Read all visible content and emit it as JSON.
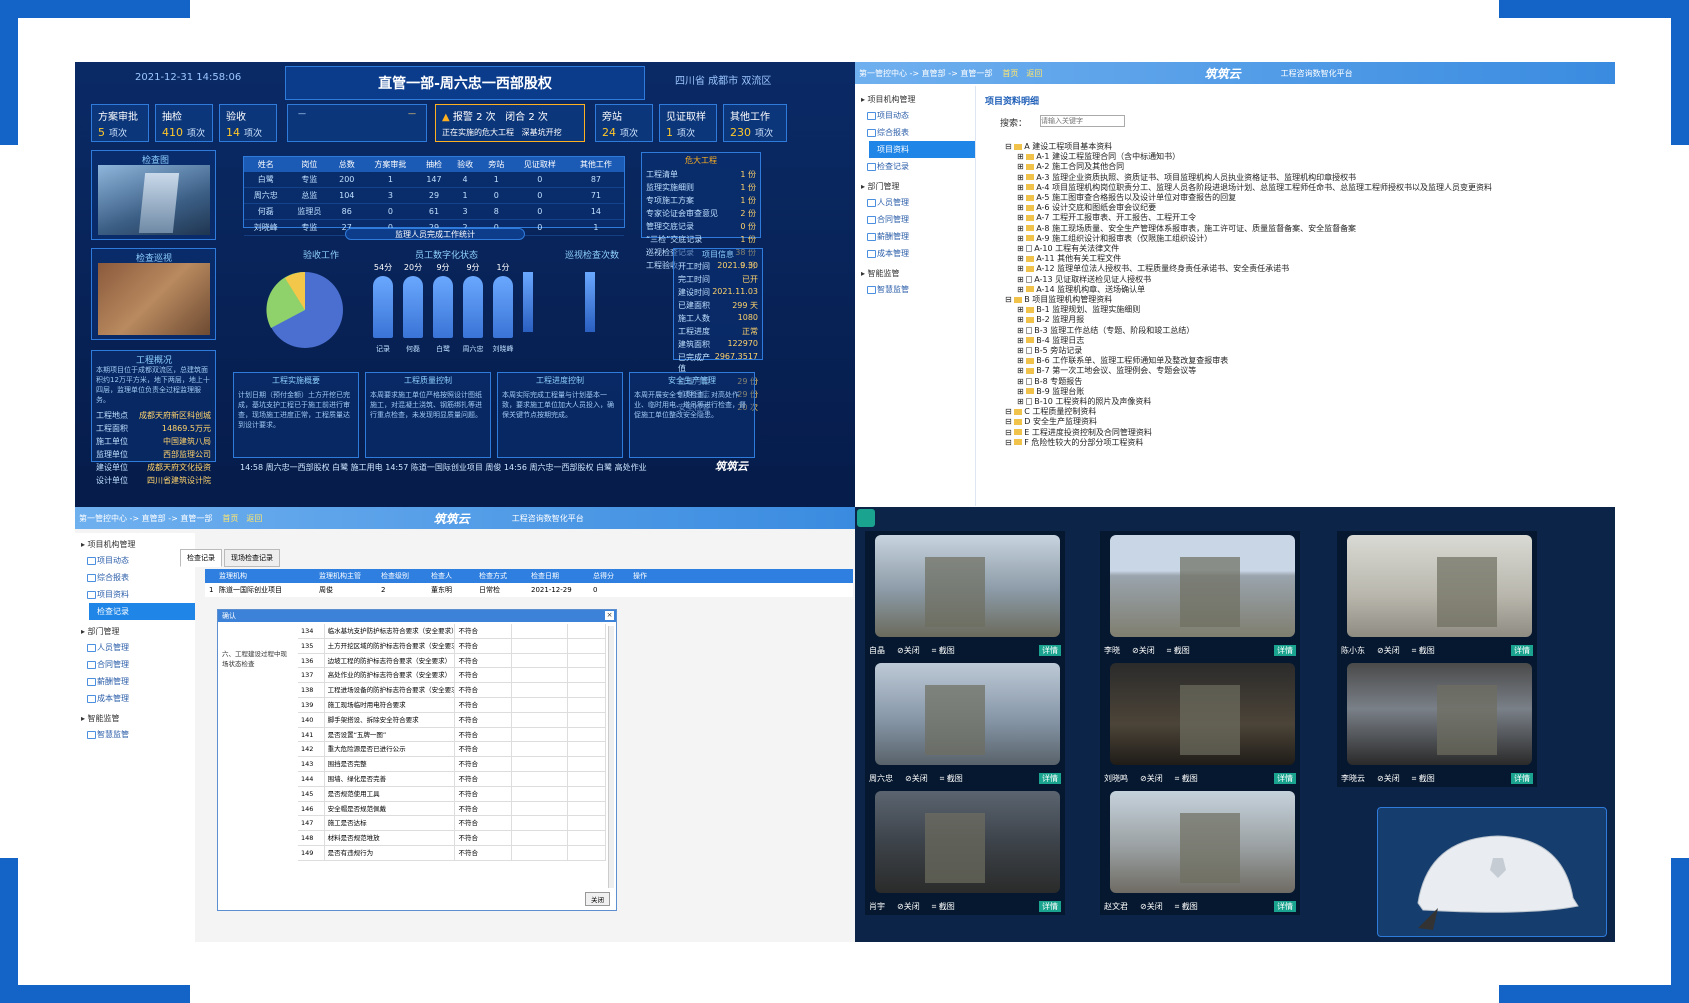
{
  "dashboard": {
    "datetime": "2021-12-31  14:58:06",
    "title": "直管一部-周六忠一西部股权",
    "location": "四川省 成都市 双流区",
    "stats": [
      {
        "label": "方案审批",
        "value": "5",
        "unit": "项次"
      },
      {
        "label": "抽检",
        "value": "410",
        "unit": "项次"
      },
      {
        "label": "验收",
        "value": "14",
        "unit": "项次"
      },
      {
        "label": "旁站",
        "value": "24",
        "unit": "项次"
      },
      {
        "label": "见证取样",
        "value": "1",
        "unit": "项次"
      },
      {
        "label": "其他工作",
        "value": "230",
        "unit": "项次"
      }
    ],
    "alarm": {
      "label": "报警",
      "count": "2 次",
      "label2": "闭合",
      "count2": "2 次",
      "note": "正在实施的危大工程",
      "note2": "深基坑开挖"
    },
    "section_img1": "检查图",
    "section_img2": "检查巡视",
    "table_headers": [
      "姓名",
      "岗位",
      "总数",
      "方案审批",
      "抽检",
      "验收",
      "旁站",
      "见证取样",
      "其他工作"
    ],
    "table_rows": [
      [
        "白鹭",
        "专监",
        "200",
        "1",
        "147",
        "4",
        "1",
        "0",
        "87"
      ],
      [
        "周六忠",
        "总监",
        "104",
        "3",
        "29",
        "1",
        "0",
        "0",
        "71"
      ],
      [
        "何磊",
        "监理员",
        "86",
        "0",
        "61",
        "3",
        "8",
        "0",
        "14"
      ],
      [
        "刘晓峰",
        "专监",
        "27",
        "0",
        "29",
        "2",
        "0",
        "0",
        "1"
      ]
    ],
    "table_footer": "监理人员完成工作统计",
    "danger_title": "危大工程",
    "danger_items": [
      [
        "工程清单",
        "1 份"
      ],
      [
        "监理实施细则",
        "1 份"
      ],
      [
        "专项施工方案",
        "1 份"
      ],
      [
        "专家论证会审查意见",
        "2 份"
      ],
      [
        "管理交底记录",
        "0 份"
      ],
      [
        "“三检”交底记录",
        "1 份"
      ],
      [
        "巡视检查记录",
        "38 份"
      ],
      [
        "工程验收",
        "0 份"
      ]
    ],
    "pie_title": "验收工作",
    "workers_title": "员工数字化状态",
    "workers": [
      {
        "time": "54分",
        "name": "记录"
      },
      {
        "time": "20分",
        "name": "何磊"
      },
      {
        "time": "9分",
        "name": "白鹭"
      },
      {
        "time": "9分",
        "name": "周六忠"
      },
      {
        "time": "1分",
        "name": "刘晓峰"
      }
    ],
    "bars_title": "巡视检查次数",
    "proj_title": "项目信息",
    "proj_items": [
      [
        "开工时间",
        "2021.9.30"
      ],
      [
        "完工时间",
        "已开"
      ],
      [
        "建设时间",
        "2021.11.03"
      ],
      [
        "已建面积",
        "299 天"
      ],
      [
        "施工人数",
        "1080"
      ],
      [
        "工程进度",
        "正常"
      ],
      [
        "建筑面积",
        "122970"
      ],
      [
        "已完成产值",
        "2967.3517"
      ],
      [
        "监理月报",
        "29 份"
      ],
      [
        "监理日志",
        "29 份"
      ],
      [
        "安全检查",
        "20 次"
      ]
    ],
    "overview_title": "工程概况",
    "overview_text": "本期项目位于成都双流区，总建筑面积约12万平方米，地下两层，地上十四层，监理单位负责全过程监理服务。",
    "overview_kv": [
      [
        "工程地点",
        "成都天府新区科创城"
      ],
      [
        "工程面积",
        "14869.5万元"
      ],
      [
        "施工单位",
        "中国建筑八局"
      ],
      [
        "监理单位",
        "西部监理公司"
      ],
      [
        "建设单位",
        "成都天府文化投资"
      ],
      [
        "设计单位",
        "四川省建筑设计院"
      ]
    ],
    "boxes": [
      {
        "title": "工程实施概要",
        "text": "计划日期（预付金额）土方开挖已完成，基坑支护工程已于施工前进行审查，现场施工进度正常，工程质量达到设计要求。"
      },
      {
        "title": "工程质量控制",
        "text": "本周要求施工单位严格按照设计图纸施工，对混凝土浇筑、钢筋绑扎等进行重点检查，未发现明显质量问题。"
      },
      {
        "title": "工程进度控制",
        "text": "本周实际完成工程量与计划基本一致，要求施工单位加大人员投入，确保关键节点按期完成。"
      },
      {
        "title": "安全生产管理",
        "text": "本周开展安全专项检查，对高处作业、临时用电、塔吊等进行检查，督促施工单位整改安全隐患。"
      }
    ],
    "ticker": "14:58  周六忠一西部股权  白鹭  施工用电    14:57  陈道一国际创业项目  周俊    14:56  周六忠一西部股权  白鹭  高处作业",
    "brand": "筑筑云"
  },
  "docs": {
    "breadcrumb": "第一管控中心 -> 直管部 -> 直管一部",
    "crumb_tabs": [
      "首页",
      "返回"
    ],
    "brand": "筑筑云",
    "brand_sub": "工程咨询数智化平台",
    "side": [
      {
        "group": "项目机构管理",
        "items": [
          "项目动态",
          "综合报表",
          "项目资料",
          "检查记录"
        ],
        "active": 2
      },
      {
        "group": "部门管理",
        "items": [
          "人员管理",
          "合同管理",
          "薪酬管理",
          "成本管理"
        ],
        "active": -1
      },
      {
        "group": "智能监管",
        "items": [
          "智慧监管"
        ],
        "active": -1
      }
    ],
    "section_title": "项目资料明细",
    "search_label": "搜索：",
    "search_placeholder": "请输入关键字",
    "tree": [
      "A 建设工程项目基本资料",
      "A-1 建设工程监理合同（含中标通知书）",
      "A-2 施工合同及其他合同",
      "A-3 监理企业资质执照、资质证书、项目监理机构人员执业资格证书、监理机构印章授权书",
      "A-4 项目监理机构岗位职责分工、监理人员各阶段进退场计划、总监理工程师任命书、总监理工程师授权书以及监理人员变更资料",
      "A-5 施工图审查合格报告以及设计单位对审查报告的回复",
      "A-6 设计交底和图纸会审会议纪要",
      "A-7 工程开工报审表、开工报告、工程开工令",
      "A-8 施工现场质量、安全生产管理体系报审表，施工许可证、质量监督备案、安全监督备案",
      "A-9 施工组织设计和报审表（仅限施工组织设计）",
      "A-10 工程有关法律文件",
      "A-11 其他有关工程文件",
      "A-12 监理单位法人授权书、工程质量终身责任承诺书、安全责任承诺书",
      "A-13 见证取样送检见证人授权书",
      "A-14 监理机构章、送场确认单",
      "B 项目监理机构管理资料",
      "B-1 监理规划、监理实施细则",
      "B-2 监理月报",
      "B-3 监理工作总结（专题、阶段和竣工总结）",
      "B-4 监理日志",
      "B-5 旁站记录",
      "B-6 工作联系单、监理工程师通知单及整改复查报审表",
      "B-7 第一次工地会议、监理例会、专题会议等",
      "B-8 专题报告",
      "B-9 监理台账",
      "B-10 工程资料的照片及声像资料",
      "C 工程质量控制资料",
      "D 安全生产监理资料",
      "E 工程进度投资控制及合同管理资料",
      "F 危险性较大的分部分项工程资料"
    ]
  },
  "records": {
    "breadcrumb": "第一管控中心 -> 直管部 -> 直管一部",
    "crumb_tabs": [
      "首页",
      "返回"
    ],
    "brand": "筑筑云",
    "brand_sub": "工程咨询数智化平台",
    "side": [
      {
        "group": "项目机构管理",
        "items": [
          "项目动态",
          "综合报表",
          "项目资料",
          "检查记录"
        ],
        "active": 3
      },
      {
        "group": "部门管理",
        "items": [
          "人员管理",
          "合同管理",
          "薪酬管理",
          "成本管理"
        ],
        "active": -1
      },
      {
        "group": "智能监管",
        "items": [
          "智慧监管"
        ],
        "active": -1
      }
    ],
    "tabs": [
      "检查记录",
      "现场检查记录"
    ],
    "headers": [
      "",
      "监理机构",
      "监理机构主管",
      "检查级别",
      "检查人",
      "检查方式",
      "检查日期",
      "总得分",
      "操作"
    ],
    "row": [
      "1",
      "陈道一国际创业项目",
      "周俊",
      "2",
      "董东明",
      "日常检",
      "2021-12-29",
      "0",
      ""
    ],
    "dialog_title": "确认",
    "category": "六、工程建设过程中现场状态检查",
    "items": [
      [
        "134",
        "临水基坑支护防护标志符合要求（安全要求）",
        "不符合"
      ],
      [
        "135",
        "土方开挖区域的防护标志符合要求（安全要求）",
        "不符合"
      ],
      [
        "136",
        "边坡工程的防护标志符合要求（安全要求）",
        "不符合"
      ],
      [
        "137",
        "高处作业的防护标志符合要求（安全要求）",
        "不符合"
      ],
      [
        "138",
        "工程进场设备的防护标志符合要求（安全要求）",
        "不符合"
      ],
      [
        "139",
        "施工现场临时用电符合要求",
        "不符合"
      ],
      [
        "140",
        "脚手架搭设、拆除安全符合要求",
        "不符合"
      ],
      [
        "141",
        "是否设置“五牌一图”",
        "不符合"
      ],
      [
        "142",
        "重大危险源是否已进行公示",
        "不符合"
      ],
      [
        "143",
        "围挡是否完整",
        "不符合"
      ],
      [
        "144",
        "围墙、绿化是否完善",
        "不符合"
      ],
      [
        "145",
        "是否规范使用工具",
        "不符合"
      ],
      [
        "146",
        "安全帽是否规范佩戴",
        "不符合"
      ],
      [
        "147",
        "施工是否达标",
        "不符合"
      ],
      [
        "148",
        "材料是否规范堆放",
        "不符合"
      ],
      [
        "149",
        "是否有违规行为",
        "不符合"
      ]
    ],
    "close_label": "关闭"
  },
  "cameras": {
    "close_label": "关闭",
    "shot_label": "截图",
    "detail_label": "详情",
    "feeds": [
      "自晶",
      "李晓",
      "陈小东",
      "周六忠",
      "刘晓鸣",
      "李晓云",
      "肖宇",
      "赵文君"
    ]
  },
  "colors": {
    "accent": "#1464c8",
    "dash_bg": "#0a2a66",
    "cam_bg": "#0b2448"
  }
}
